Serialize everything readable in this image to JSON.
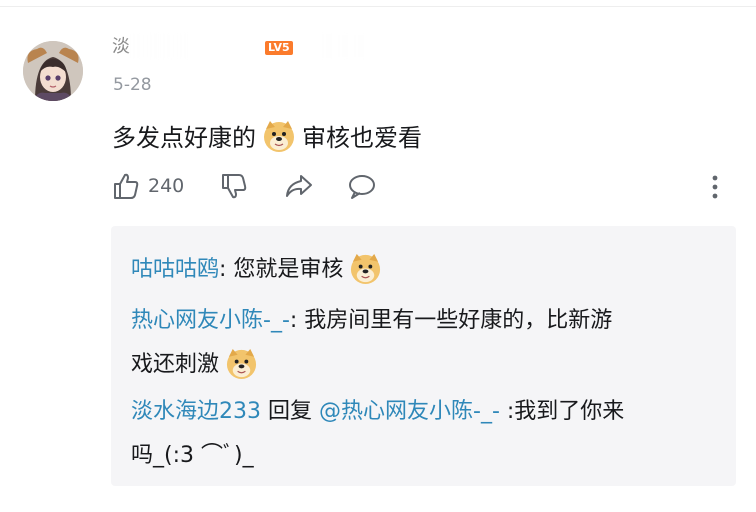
{
  "comment": {
    "username": "淡",
    "level_badge": "LV5",
    "date": "5-28",
    "text_part1": "多发点好康的",
    "text_part2": "审核也爱看",
    "emoji_name": "doge-emoji",
    "like_count": "240"
  },
  "replies": [
    {
      "user": "咕咕咕鸥",
      "text": ": 您就是审核",
      "emoji_after": true
    },
    {
      "user": "热心网友小陈-_-",
      "text_line1": ": 我房间里有一些好康的，比新游",
      "text_line2": "戏还刺激",
      "emoji_after": true
    },
    {
      "user": "淡水海边233",
      "reply_word": " 回复 ",
      "mention": "@热心网友小陈-_-",
      "text_line1": " :我到了你来",
      "text_line2": "吗_(:3 ⌒ﾞ)_"
    }
  ],
  "icons": {
    "like": "thumbs-up-icon",
    "dislike": "thumbs-down-icon",
    "share": "share-icon",
    "reply": "comment-icon",
    "more": "more-vertical-icon"
  },
  "colors": {
    "link": "#2f88b9",
    "level_badge": "#fb7b2c",
    "reply_bg": "#f5f5f7"
  }
}
